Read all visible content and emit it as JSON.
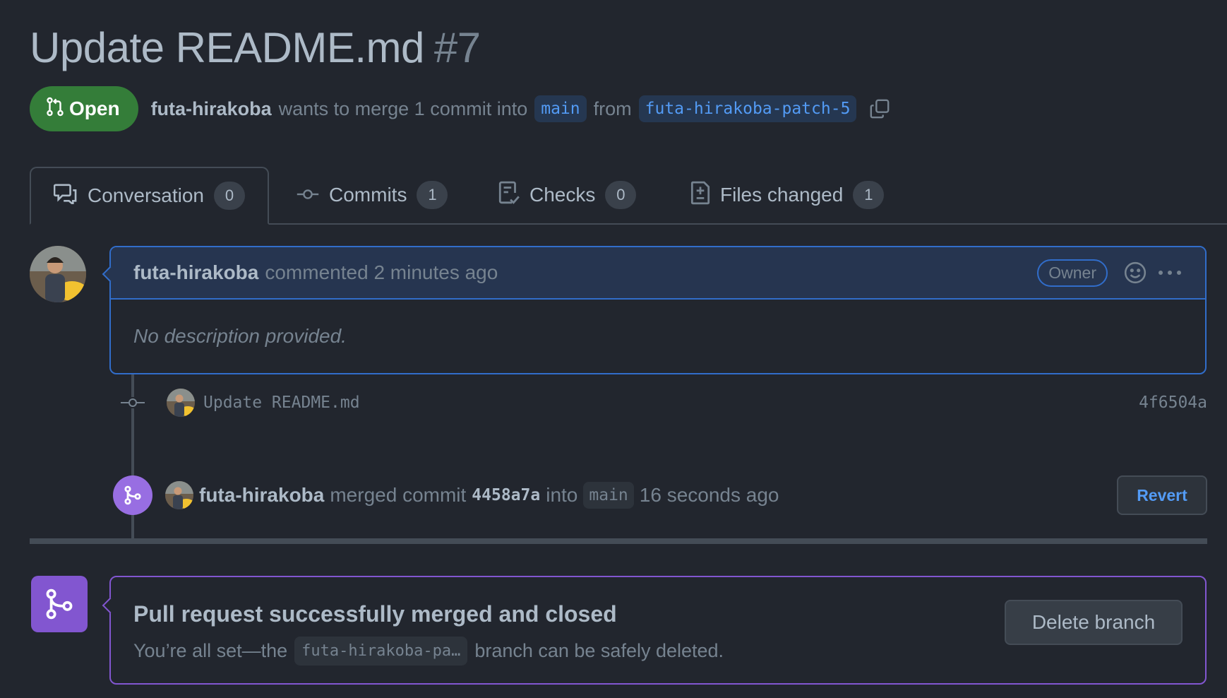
{
  "pr": {
    "title": "Update README.md",
    "number": "#7",
    "state": "Open",
    "author": "futa-hirakoba",
    "summary_a": "wants to merge 1 commit into",
    "base_branch": "main",
    "summary_b": "from",
    "head_branch": "futa-hirakoba-patch-5"
  },
  "tabs": [
    {
      "label": "Conversation",
      "count": "0",
      "icon": "comment-discussion-icon"
    },
    {
      "label": "Commits",
      "count": "1",
      "icon": "git-commit-icon"
    },
    {
      "label": "Checks",
      "count": "0",
      "icon": "checklist-icon"
    },
    {
      "label": "Files changed",
      "count": "1",
      "icon": "file-diff-icon"
    }
  ],
  "comment": {
    "author": "futa-hirakoba",
    "action": "commented",
    "time": "2 minutes ago",
    "badge": "Owner",
    "body": "No description provided."
  },
  "commit": {
    "message": "Update README.md",
    "sha": "4f6504a"
  },
  "merge_event": {
    "author": "futa-hirakoba",
    "action": "merged commit",
    "sha": "4458a7a",
    "into": "into",
    "branch": "main",
    "time": "16 seconds ago",
    "revert_label": "Revert"
  },
  "merged_box": {
    "title": "Pull request successfully merged and closed",
    "sub_a": "You’re all set—the",
    "branch": "futa-hirakoba-pa…",
    "sub_b": "branch can be safely deleted.",
    "delete_label": "Delete branch"
  },
  "colors": {
    "background": "#22262e",
    "open_green": "#347d39",
    "merged_purple": "#8256d0",
    "accent_blue": "#539bf5"
  }
}
